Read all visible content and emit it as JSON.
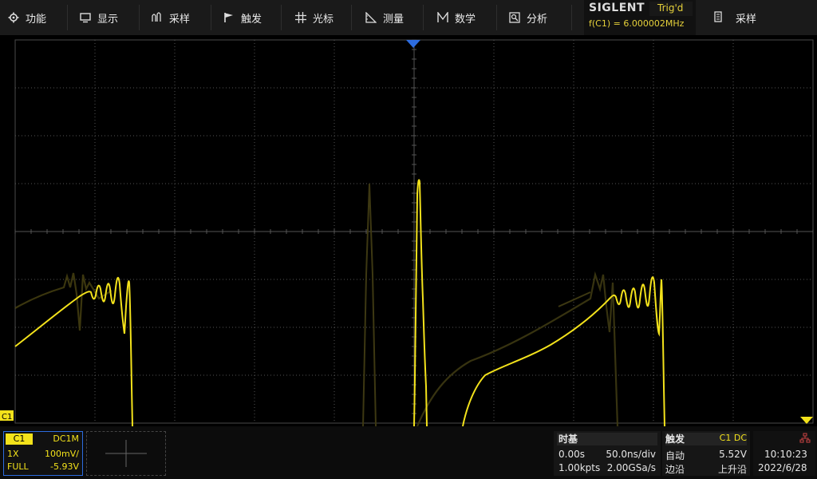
{
  "menu": {
    "items": [
      {
        "label": "功能",
        "icon": "gear-icon"
      },
      {
        "label": "显示",
        "icon": "monitor-icon"
      },
      {
        "label": "采样",
        "icon": "acquire-icon"
      },
      {
        "label": "触发",
        "icon": "flag-icon"
      },
      {
        "label": "光标",
        "icon": "cursor-crosshair-icon"
      },
      {
        "label": "测量",
        "icon": "ruler-icon"
      },
      {
        "label": "数学",
        "icon": "math-icon"
      },
      {
        "label": "分析",
        "icon": "analysis-icon"
      }
    ],
    "right_item": {
      "label": "采样",
      "icon": "memory-icon"
    }
  },
  "brand": {
    "name": "SIGLENT",
    "trigger_status": "Trig'd",
    "frequency": "f(C1) = 6.000002MHz"
  },
  "screen": {
    "channel_marker": "C1",
    "trace_color": "#f3e21b",
    "grid_color": "#555555",
    "trigger_marker_color": "#2d6cdf"
  },
  "channel": {
    "name": "C1",
    "coupling": "DC1M",
    "probe": "1X",
    "scale": "100mV/",
    "bandwidth": "FULL",
    "offset": "-5.93V"
  },
  "timebase": {
    "title": "时基",
    "delay": "0.00s",
    "scale": "50.0ns/div",
    "points": "1.00kpts",
    "rate": "2.00GSa/s"
  },
  "trigger": {
    "title": "触发",
    "source": "C1 DC",
    "mode": "自动",
    "level": "5.52V",
    "type": "边沿",
    "slope": "上升沿"
  },
  "clock": {
    "time": "10:10:23",
    "date": "2022/6/28"
  }
}
